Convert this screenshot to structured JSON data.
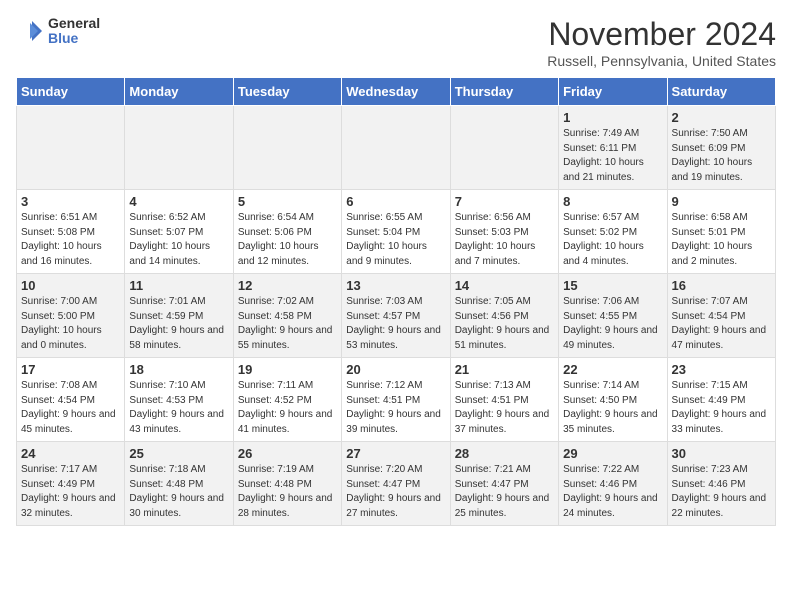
{
  "logo": {
    "general": "General",
    "blue": "Blue"
  },
  "title": "November 2024",
  "location": "Russell, Pennsylvania, United States",
  "days_of_week": [
    "Sunday",
    "Monday",
    "Tuesday",
    "Wednesday",
    "Thursday",
    "Friday",
    "Saturday"
  ],
  "weeks": [
    [
      {
        "day": "",
        "info": ""
      },
      {
        "day": "",
        "info": ""
      },
      {
        "day": "",
        "info": ""
      },
      {
        "day": "",
        "info": ""
      },
      {
        "day": "",
        "info": ""
      },
      {
        "day": "1",
        "info": "Sunrise: 7:49 AM\nSunset: 6:11 PM\nDaylight: 10 hours and 21 minutes."
      },
      {
        "day": "2",
        "info": "Sunrise: 7:50 AM\nSunset: 6:09 PM\nDaylight: 10 hours and 19 minutes."
      }
    ],
    [
      {
        "day": "3",
        "info": "Sunrise: 6:51 AM\nSunset: 5:08 PM\nDaylight: 10 hours and 16 minutes."
      },
      {
        "day": "4",
        "info": "Sunrise: 6:52 AM\nSunset: 5:07 PM\nDaylight: 10 hours and 14 minutes."
      },
      {
        "day": "5",
        "info": "Sunrise: 6:54 AM\nSunset: 5:06 PM\nDaylight: 10 hours and 12 minutes."
      },
      {
        "day": "6",
        "info": "Sunrise: 6:55 AM\nSunset: 5:04 PM\nDaylight: 10 hours and 9 minutes."
      },
      {
        "day": "7",
        "info": "Sunrise: 6:56 AM\nSunset: 5:03 PM\nDaylight: 10 hours and 7 minutes."
      },
      {
        "day": "8",
        "info": "Sunrise: 6:57 AM\nSunset: 5:02 PM\nDaylight: 10 hours and 4 minutes."
      },
      {
        "day": "9",
        "info": "Sunrise: 6:58 AM\nSunset: 5:01 PM\nDaylight: 10 hours and 2 minutes."
      }
    ],
    [
      {
        "day": "10",
        "info": "Sunrise: 7:00 AM\nSunset: 5:00 PM\nDaylight: 10 hours and 0 minutes."
      },
      {
        "day": "11",
        "info": "Sunrise: 7:01 AM\nSunset: 4:59 PM\nDaylight: 9 hours and 58 minutes."
      },
      {
        "day": "12",
        "info": "Sunrise: 7:02 AM\nSunset: 4:58 PM\nDaylight: 9 hours and 55 minutes."
      },
      {
        "day": "13",
        "info": "Sunrise: 7:03 AM\nSunset: 4:57 PM\nDaylight: 9 hours and 53 minutes."
      },
      {
        "day": "14",
        "info": "Sunrise: 7:05 AM\nSunset: 4:56 PM\nDaylight: 9 hours and 51 minutes."
      },
      {
        "day": "15",
        "info": "Sunrise: 7:06 AM\nSunset: 4:55 PM\nDaylight: 9 hours and 49 minutes."
      },
      {
        "day": "16",
        "info": "Sunrise: 7:07 AM\nSunset: 4:54 PM\nDaylight: 9 hours and 47 minutes."
      }
    ],
    [
      {
        "day": "17",
        "info": "Sunrise: 7:08 AM\nSunset: 4:54 PM\nDaylight: 9 hours and 45 minutes."
      },
      {
        "day": "18",
        "info": "Sunrise: 7:10 AM\nSunset: 4:53 PM\nDaylight: 9 hours and 43 minutes."
      },
      {
        "day": "19",
        "info": "Sunrise: 7:11 AM\nSunset: 4:52 PM\nDaylight: 9 hours and 41 minutes."
      },
      {
        "day": "20",
        "info": "Sunrise: 7:12 AM\nSunset: 4:51 PM\nDaylight: 9 hours and 39 minutes."
      },
      {
        "day": "21",
        "info": "Sunrise: 7:13 AM\nSunset: 4:51 PM\nDaylight: 9 hours and 37 minutes."
      },
      {
        "day": "22",
        "info": "Sunrise: 7:14 AM\nSunset: 4:50 PM\nDaylight: 9 hours and 35 minutes."
      },
      {
        "day": "23",
        "info": "Sunrise: 7:15 AM\nSunset: 4:49 PM\nDaylight: 9 hours and 33 minutes."
      }
    ],
    [
      {
        "day": "24",
        "info": "Sunrise: 7:17 AM\nSunset: 4:49 PM\nDaylight: 9 hours and 32 minutes."
      },
      {
        "day": "25",
        "info": "Sunrise: 7:18 AM\nSunset: 4:48 PM\nDaylight: 9 hours and 30 minutes."
      },
      {
        "day": "26",
        "info": "Sunrise: 7:19 AM\nSunset: 4:48 PM\nDaylight: 9 hours and 28 minutes."
      },
      {
        "day": "27",
        "info": "Sunrise: 7:20 AM\nSunset: 4:47 PM\nDaylight: 9 hours and 27 minutes."
      },
      {
        "day": "28",
        "info": "Sunrise: 7:21 AM\nSunset: 4:47 PM\nDaylight: 9 hours and 25 minutes."
      },
      {
        "day": "29",
        "info": "Sunrise: 7:22 AM\nSunset: 4:46 PM\nDaylight: 9 hours and 24 minutes."
      },
      {
        "day": "30",
        "info": "Sunrise: 7:23 AM\nSunset: 4:46 PM\nDaylight: 9 hours and 22 minutes."
      }
    ]
  ]
}
